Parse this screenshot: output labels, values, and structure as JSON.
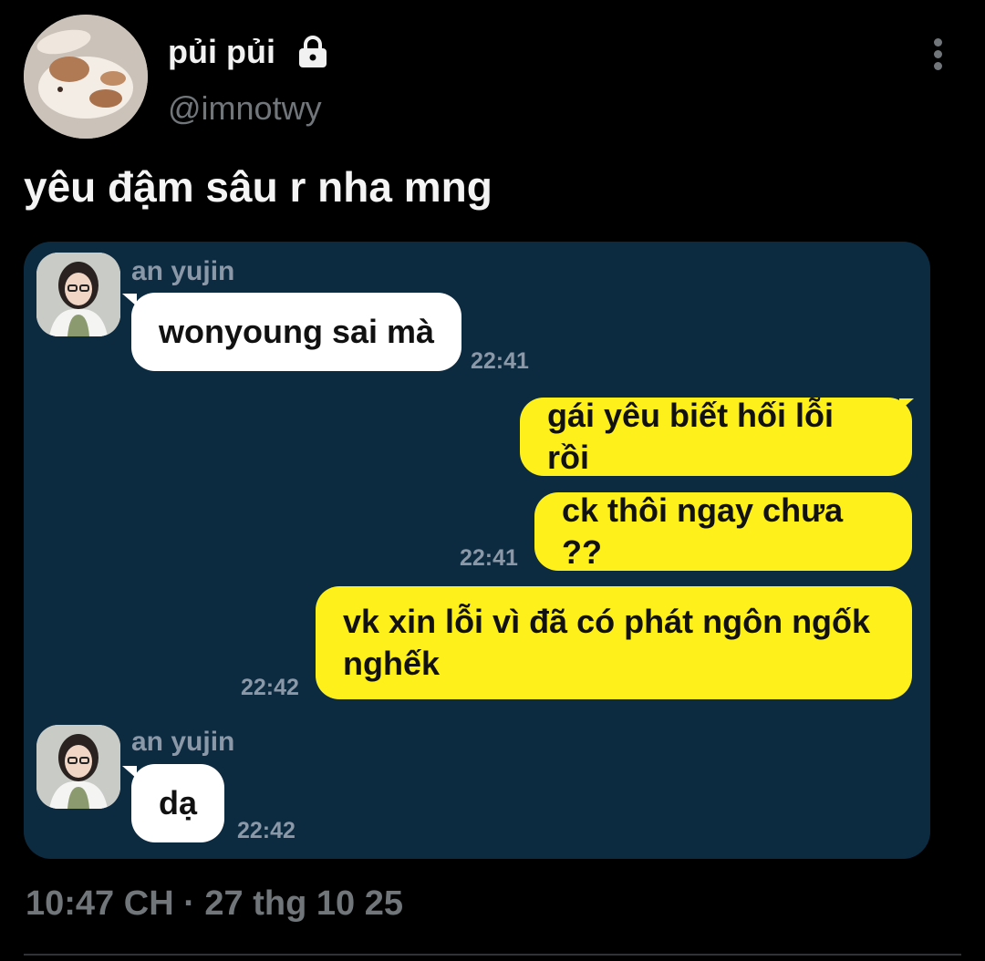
{
  "tweet": {
    "display_name": "pủi pủi",
    "handle": "@imnotwy",
    "text": "yêu đậm sâu r nha mng",
    "timestamp": "10:47 CH · 27 thg 10 25",
    "icons": {
      "lock": "lock-icon",
      "more": "more-vertical-icon"
    }
  },
  "chat": {
    "messages": [
      {
        "sender": "an yujin",
        "text": "wonyoung sai mà",
        "time": "22:41",
        "side": "left"
      },
      {
        "text": "gái yêu biết hối lỗi rồi",
        "side": "right"
      },
      {
        "text": "ck thôi ngay chưa ??",
        "time": "22:41",
        "side": "right"
      },
      {
        "text_line1": "vk xin lỗi vì đã có phát ngôn ngốk",
        "text_line2": "nghếk",
        "time": "22:42",
        "side": "right"
      },
      {
        "sender": "an yujin",
        "text": "dạ",
        "time": "22:42",
        "side": "left"
      }
    ]
  },
  "colors": {
    "background": "#000000",
    "chat_background": "#0d2b40",
    "incoming_bubble": "#ffffff",
    "outgoing_bubble": "#fef01b",
    "muted_text": "#71767b"
  }
}
